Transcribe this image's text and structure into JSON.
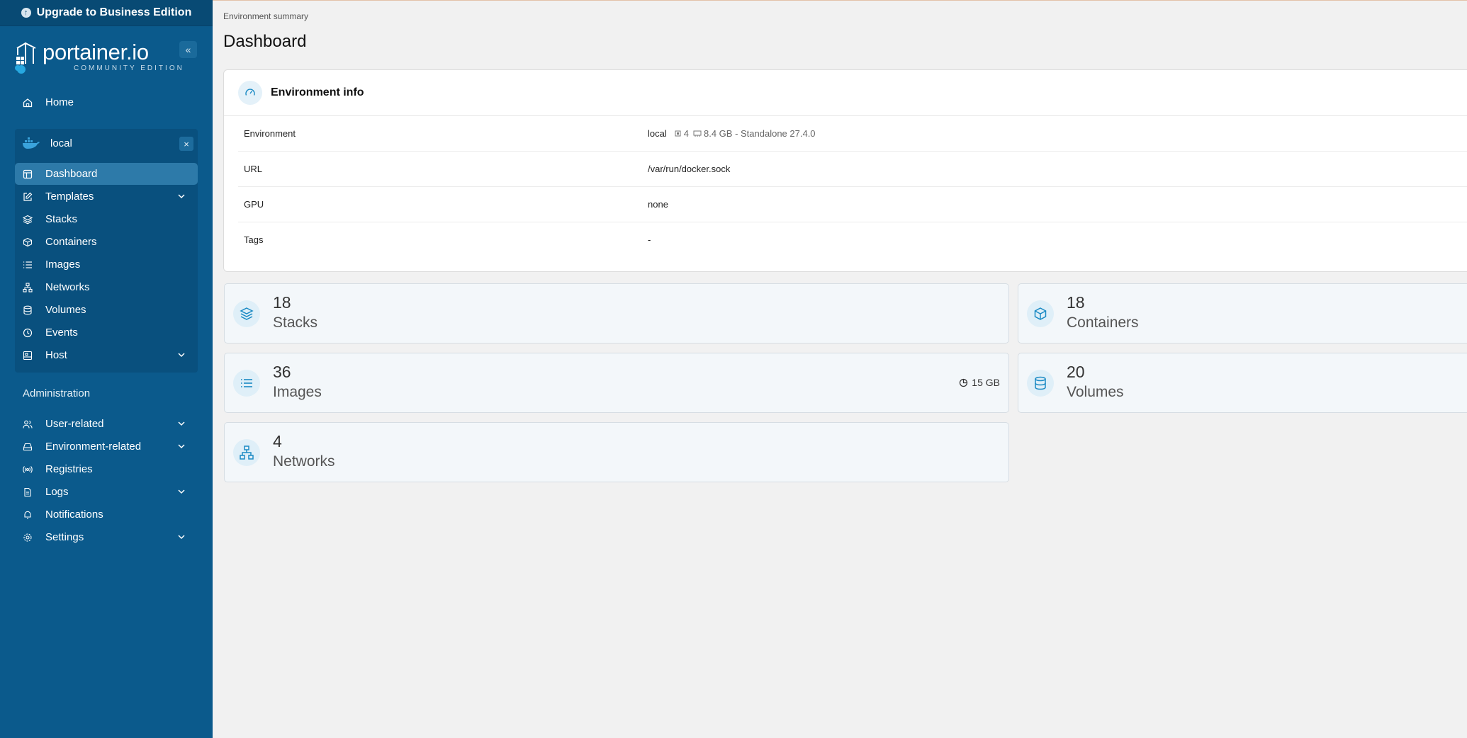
{
  "upgrade": {
    "label": "Upgrade to Business Edition"
  },
  "logo": {
    "name": "portainer.io",
    "edition": "COMMUNITY EDITION"
  },
  "sidebar": {
    "home": "Home",
    "environment": {
      "name": "local",
      "close": "×"
    },
    "env_items": [
      {
        "label": "Dashboard",
        "icon": "layout-icon",
        "active": true
      },
      {
        "label": "Templates",
        "icon": "edit-icon",
        "expandable": true
      },
      {
        "label": "Stacks",
        "icon": "layers-icon"
      },
      {
        "label": "Containers",
        "icon": "box-icon"
      },
      {
        "label": "Images",
        "icon": "list-icon"
      },
      {
        "label": "Networks",
        "icon": "network-icon"
      },
      {
        "label": "Volumes",
        "icon": "database-icon"
      },
      {
        "label": "Events",
        "icon": "clock-icon"
      },
      {
        "label": "Host",
        "icon": "host-icon",
        "expandable": true
      }
    ],
    "admin_title": "Administration",
    "admin_items": [
      {
        "label": "User-related",
        "icon": "users-icon",
        "expandable": true
      },
      {
        "label": "Environment-related",
        "icon": "hard-drive-icon",
        "expandable": true
      },
      {
        "label": "Registries",
        "icon": "radio-icon"
      },
      {
        "label": "Logs",
        "icon": "file-icon",
        "expandable": true
      },
      {
        "label": "Notifications",
        "icon": "bell-icon"
      },
      {
        "label": "Settings",
        "icon": "gear-icon",
        "expandable": true
      }
    ]
  },
  "breadcrumb": "Environment summary",
  "page_title": "Dashboard",
  "env_info": {
    "title": "Environment info",
    "rows": {
      "environment": {
        "key": "Environment",
        "name": "local",
        "cpu": "4",
        "memory": "8.4 GB - Standalone 27.4.0"
      },
      "url": {
        "key": "URL",
        "value": "/var/run/docker.sock"
      },
      "gpu": {
        "key": "GPU",
        "value": "none"
      },
      "tags": {
        "key": "Tags",
        "value": "-"
      }
    }
  },
  "stats": {
    "stacks": {
      "count": "18",
      "label": "Stacks"
    },
    "containers": {
      "count": "18",
      "label": "Containers"
    },
    "images": {
      "count": "36",
      "label": "Images",
      "size": "15 GB"
    },
    "volumes": {
      "count": "20",
      "label": "Volumes"
    },
    "networks": {
      "count": "4",
      "label": "Networks"
    }
  },
  "colors": {
    "sidebar": "#0b5a8c",
    "accent": "#1a8ac4",
    "active_item": "#2d7aa9"
  }
}
